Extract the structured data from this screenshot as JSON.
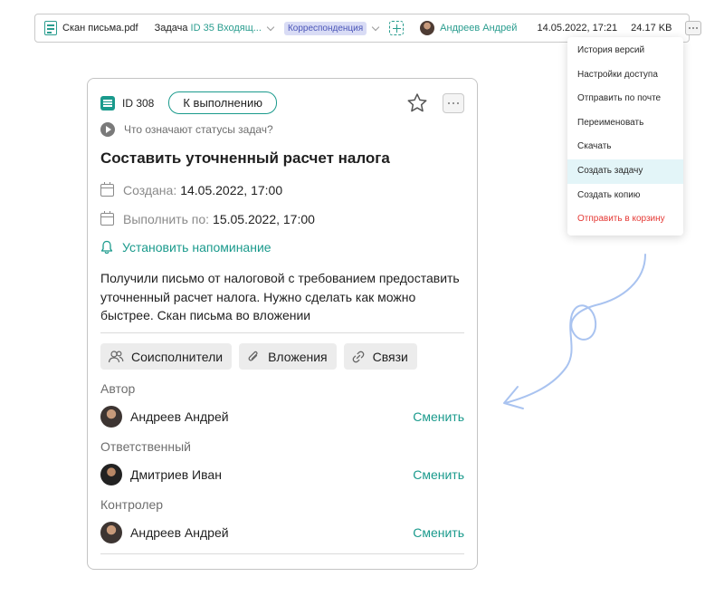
{
  "docbar": {
    "file_name": "Скан письма.pdf",
    "task_label": "Задача",
    "task_value": "ID 35 Входящ...",
    "category": "Корреспонденция",
    "owner": "Андреев Андрей",
    "datetime": "14.05.2022, 17:21",
    "file_size": "24.17 KB"
  },
  "menu": {
    "items": [
      {
        "label": "История версий"
      },
      {
        "label": "Настройки доступа"
      },
      {
        "label": "Отправить по почте"
      },
      {
        "label": "Переименовать"
      },
      {
        "label": "Скачать"
      },
      {
        "label": "Создать задачу",
        "state": "hovered"
      },
      {
        "label": "Создать копию"
      },
      {
        "label": "Отправить в корзину",
        "tone": "danger"
      }
    ]
  },
  "task": {
    "id": "ID 308",
    "status": "К выполнению",
    "status_help": "Что означают статусы задач?",
    "title": "Составить уточненный расчет налога",
    "created_label": "Создана:",
    "created_value": "14.05.2022, 17:00",
    "due_label": "Выполнить по:",
    "due_value": "15.05.2022, 17:00",
    "reminder": "Установить напоминание",
    "description": "Получили письмо от налоговой с требованием предоставить уточненный расчет налога. Нужно сделать как можно быстрее. Скан письма во вложении",
    "chips": {
      "coexecutors": "Соисполнители",
      "attachments": "Вложения",
      "links": "Связи"
    },
    "roles": {
      "author": {
        "label": "Автор",
        "name": "Андреев Андрей",
        "action": "Сменить"
      },
      "responsible": {
        "label": "Ответственный",
        "name": "Дмитриев Иван",
        "action": "Сменить"
      },
      "controller": {
        "label": "Контролер",
        "name": "Андреев Андрей",
        "action": "Сменить"
      }
    }
  },
  "colors": {
    "accent": "#1a9a8c",
    "danger": "#e53935",
    "menu_hover": "#e3f5f8",
    "category_bg": "#d9dcf5",
    "arrow": "#a9c3f0"
  }
}
